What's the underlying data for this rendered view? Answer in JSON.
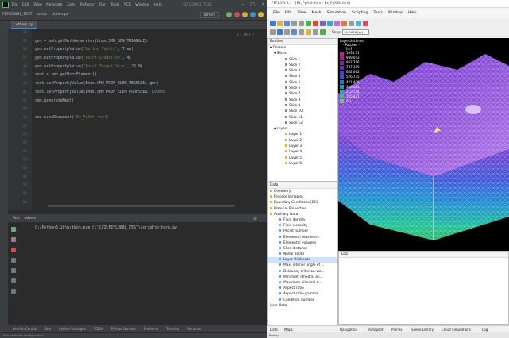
{
  "ide": {
    "menu": [
      "File",
      "Edit",
      "View",
      "Navigate",
      "Code",
      "Refactor",
      "Run",
      "Tools",
      "VCS",
      "Window",
      "Help"
    ],
    "title": "FEFLOW81_TEST",
    "breadcrumbs": [
      "FEFLOW81_TEST",
      "script",
      "others.py"
    ],
    "run_config": "others",
    "tab": "others.py",
    "inspection": "3 ↑ 18 ∧ ∨",
    "line_numbers": [
      "34",
      "35",
      "36",
      "37",
      "38",
      "39",
      "40",
      "41",
      "42",
      "43",
      "44",
      "45",
      "46",
      "47",
      "48",
      "49",
      "50",
      "51",
      "52",
      "53",
      "54"
    ],
    "code_lines": [
      {
        "pre": "",
        "str": "",
        "post": ""
      },
      {
        "pre": "gen = smh.getMeshGenerator(Enum.SMH_GEN_TRIANGLE)",
        "str": "",
        "post": ""
      },
      {
        "pre": "gen.setPropertyValue(",
        "str": "'Refine Points'",
        "post": ", True)"
      },
      {
        "pre": "gen.setPropertyValue(",
        "str": "'Point Gradation'",
        "post": ", 4)"
      },
      {
        "pre": "gen.setPropertyValue(",
        "str": "'Point Target Size'",
        "post": ", 25.0)"
      },
      {
        "pre": "root = smh.getRootElement()",
        "str": "",
        "post": ""
      },
      {
        "pre": "root.setPropertyValue(Enum.SMH_PROP_ELEM_MESHGEN, gen)",
        "str": "",
        "post": ""
      },
      {
        "pre": "root.setPropertyValue(Enum.SMH_PROP_ELEM_PROPSEED, ",
        "str": "",
        "post": "",
        "num": "10000)"
      },
      {
        "pre": "smh.generateMesh()",
        "str": "",
        "post": ""
      },
      {
        "pre": "",
        "str": "",
        "post": ""
      },
      {
        "pre": "doc.saveDocument(",
        "str": "'Ex_PyXSh_fem'",
        "post": ")"
      }
    ],
    "run_label": "Run",
    "run_tab": "others",
    "run_output": "C:\\Python3.10\\python.exe C:\\CVI\\FEFLOW81_TEST\\script\\others.py",
    "bottom_tools": [
      "Version Control",
      "Run",
      "Python Packages",
      "TODO",
      "Python Console",
      "Problems",
      "Terminal",
      "Services"
    ],
    "status": "Run selected configuration"
  },
  "feflow": {
    "title": "FEFLOW 8.1 - [Ex_PyXSh.fem - Ex_PyXSh.fem]",
    "menu": [
      "File",
      "Edit",
      "View",
      "Mesh",
      "Simulation",
      "Scripting",
      "Tools",
      "Window",
      "Help"
    ],
    "snap_label": "Snap:",
    "snap_value": "50.0048 [m]",
    "entities_title": "Entities",
    "tree": {
      "domain": "Domain",
      "slices": "Slices",
      "slice_items": [
        "Slice 1",
        "Slice 2",
        "Slice 3",
        "Slice 4",
        "Slice 5",
        "Slice 6",
        "Slice 7",
        "Slice 8",
        "Slice 9",
        "Slice 10",
        "Slice 11",
        "Slice 12"
      ],
      "layers": "Layers",
      "layer_items": [
        "Layer 1",
        "Layer 2",
        "Layer 3",
        "Layer 4",
        "Layer 5",
        "Layer 6"
      ]
    },
    "entities_tabs": [
      "P...",
      "S...",
      "Discrete..."
    ],
    "data_title": "Data",
    "data_groups": [
      "Geometry",
      "Process Variables",
      "Boundary Conditions (BC)",
      "Material Properties",
      "Auxiliary Data"
    ],
    "aux_items": [
      "Fluid density",
      "Fluid viscosity",
      "Péclet number",
      "Elemental diameters",
      "Elemental volumes",
      "Slice distance",
      "Nodal depth",
      "Layer thickness",
      "Max. interior angle of ...",
      "Delaunay criterion vio...",
      "Minimum dihedral an...",
      "Maximum dihedral a...",
      "Aspect ratio",
      "Aspect ratio gamma",
      "Condition number"
    ],
    "user_data": "User Data",
    "selected_item": "Layer thickness",
    "legend_title": "Layer thickness",
    "legend_sub": "- Patches -",
    "legend_unit": "[m]",
    "legend_values": [
      "1093.31",
      "949.043",
      "842.716",
      "737.389",
      "632.062",
      "526.735",
      "421.408",
      "316.081",
      "210.754",
      "105.427",
      "0.1"
    ],
    "legend_colors": [
      "#d9148c",
      "#b0179b",
      "#8b1cb0",
      "#6a27c8",
      "#4a3ad6",
      "#2e55e0",
      "#1d7ed8",
      "#169cc1",
      "#17b5a0",
      "#2fc479",
      "#6fd454"
    ],
    "log_title": "Log",
    "bottom_tabs": [
      "Data",
      "Maps",
      "Navigation",
      "Autopilot",
      "Planes",
      "Scene Library",
      "Cloud Simulations",
      "Log"
    ],
    "status": "Ready"
  }
}
